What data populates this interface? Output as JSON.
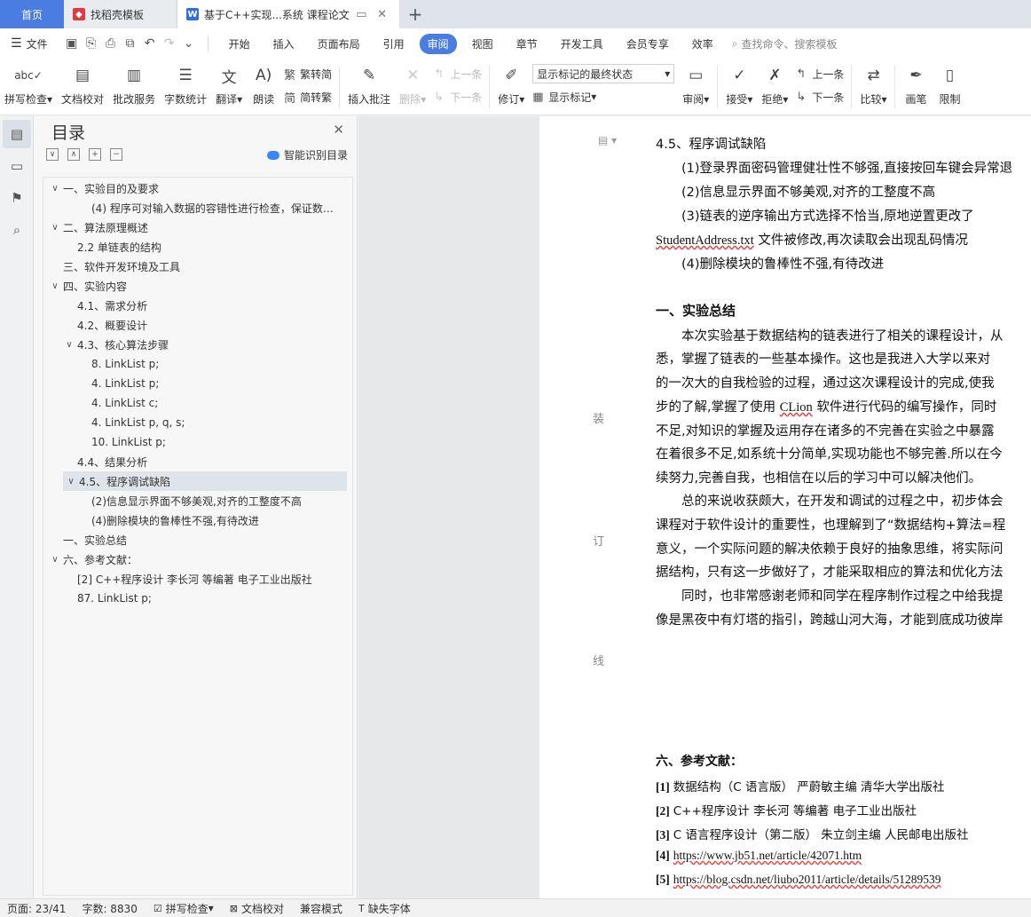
{
  "tabs": {
    "home": "首页",
    "template": "找稻壳模板",
    "doc": "基于C++实现...系统 课程论文"
  },
  "menu": {
    "file": "文件",
    "items": [
      "开始",
      "插入",
      "页面布局",
      "引用",
      "审阅",
      "视图",
      "章节",
      "开发工具",
      "会员专享",
      "效率"
    ],
    "active": "审阅",
    "search": "查找命令、搜索模板"
  },
  "ribbon": {
    "spellcheck": "拼写检查",
    "doccheck": "文档校对",
    "revise_service": "批改服务",
    "wordcount": "字数统计",
    "translate": "翻译",
    "read": "朗读",
    "to_traditional": "繁转简",
    "to_simplified": "简转繁",
    "insert_comment": "插入批注",
    "delete": "删除",
    "prev": "上一条",
    "next": "下一条",
    "track": "修订",
    "markup_select": "显示标记的最终状态",
    "show_markup": "显示标记",
    "review": "审阅",
    "accept": "接受",
    "reject": "拒绝",
    "prev2": "上一条",
    "next2": "下一条",
    "compare": "比较",
    "pen": "画笔",
    "restrict": "限制"
  },
  "toc": {
    "title": "目录",
    "smart": "智能识别目录",
    "items": [
      {
        "level": 0,
        "arrow": "∨",
        "text": "一、实验目的及要求"
      },
      {
        "level": 2,
        "arrow": "",
        "text": "(4) 程序可对输入数据的容错性进行检查，保证数…"
      },
      {
        "level": 0,
        "arrow": "∨",
        "text": "二、算法原理概述"
      },
      {
        "level": 1,
        "arrow": "",
        "text": "2.2 单链表的结构"
      },
      {
        "level": 0,
        "arrow": "",
        "text": "三、软件开发环境及工具"
      },
      {
        "level": 0,
        "arrow": "∨",
        "text": "四、实验内容"
      },
      {
        "level": 1,
        "arrow": "",
        "text": "4.1、需求分析"
      },
      {
        "level": 1,
        "arrow": "",
        "text": "4.2、概要设计"
      },
      {
        "level": 1,
        "arrow": "∨",
        "text": "4.3、核心算法步骤"
      },
      {
        "level": 2,
        "arrow": "",
        "text": "8.   LinkList p;"
      },
      {
        "level": 2,
        "arrow": "",
        "text": "4.   LinkList p;"
      },
      {
        "level": 2,
        "arrow": "",
        "text": "4.   LinkList c;"
      },
      {
        "level": 2,
        "arrow": "",
        "text": "4.   LinkList p, q, s;"
      },
      {
        "level": 2,
        "arrow": "",
        "text": "10.   LinkList p;"
      },
      {
        "level": 1,
        "arrow": "",
        "text": "4.4、结果分析"
      },
      {
        "level": 1,
        "arrow": "∨",
        "text": "4.5、程序调试缺陷",
        "selected": true
      },
      {
        "level": 2,
        "arrow": "",
        "text": "(2)信息显示界面不够美观,对齐的工整度不高"
      },
      {
        "level": 2,
        "arrow": "",
        "text": "(4)删除模块的鲁棒性不强,有待改进"
      },
      {
        "level": 0,
        "arrow": "",
        "text": "一、实验总结"
      },
      {
        "level": 0,
        "arrow": "∨",
        "text": "六、参考文献："
      },
      {
        "level": 1,
        "arrow": "",
        "text": "[2] C++程序设计  李长河  等编著  电子工业出版社"
      },
      {
        "level": 1,
        "arrow": "",
        "text": "87.   LinkList p;"
      }
    ]
  },
  "page": {
    "bind_marks": [
      "装",
      "订",
      "线"
    ],
    "section_title": "4.5、程序调试缺陷",
    "bug1": "(1)登录界面密码管理健壮性不够强,直接按回车键会异常退",
    "bug2": "(2)信息显示界面不够美观,对齐的工整度不高",
    "bug3": "(3)链表的逆序输出方式选择不恰当,原地逆置更改了",
    "bug3b_file": "StudentAddress.txt",
    "bug3b_rest": " 文件被修改,再次读取会出现乱码情况",
    "bug4": "(4)删除模块的鲁棒性不强,有待改进",
    "summary_title": "一、实验总结",
    "p1": [
      "本次实验基于数据结构的链表进行了相关的课程设计，从",
      "悉，掌握了链表的一些基本操作。这也是我进入大学以来对",
      "的一次大的自我检验的过程，通过这次课程设计的完成,使我",
      "步的了解,掌握了使用 ",
      "不足,对知识的掌握及运用存在诸多的不完善在实验之中暴露",
      "在着很多不足,如系统十分简单,实现功能也不够完善.所以在今",
      "续努力,完善自我，也相信在以后的学习中可以解决他们。"
    ],
    "clion": "CLion",
    "p1_line4_rest": " 软件进行代码的编写操作，同时",
    "p2": [
      "总的来说收获颇大，在开发和调试的过程之中，初步体会",
      "课程对于软件设计的重要性，也理解到了“数据结构+算法=程",
      "意义，一个实际问题的解决依赖于良好的抽象思维，将实际问",
      "据结构，只有这一步做好了，才能采取相应的算法和优化方法"
    ],
    "p3": [
      "同时，也非常感谢老师和同学在程序制作过程之中给我提",
      "像是黑夜中有灯塔的指引，跨越山河大海，才能到底成功彼岸"
    ],
    "ref_title": "六、参考文献：",
    "refs": [
      {
        "num": "[1]",
        "text": "数据结构（C 语言版）  严蔚敏主编    清华大学出版社"
      },
      {
        "num": "[2]",
        "text": "C++程序设计  李长河  等编著  电子工业出版社"
      },
      {
        "num": "[3]",
        "text": "C 语言程序设计（第二版）  朱立剑主编  人民邮电出版社"
      },
      {
        "num": "[4]",
        "text": "",
        "link": "https://www.jb51.net/article/42071.htm"
      },
      {
        "num": "[5]",
        "text": "",
        "link": "https://blog.csdn.net/liubo2011/article/details/51289539"
      }
    ]
  },
  "status": {
    "page": "页面: 23/41",
    "words": "字数: 8830",
    "spell": "拼写检查",
    "doccheck": "文档校对",
    "compat": "兼容模式",
    "missing_font": "缺失字体"
  }
}
